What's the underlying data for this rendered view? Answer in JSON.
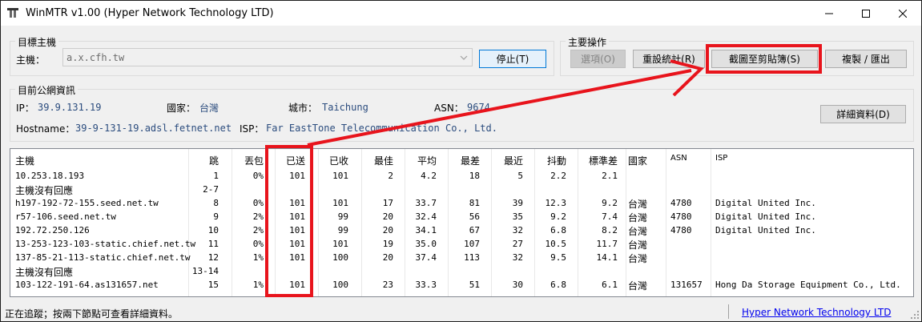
{
  "window": {
    "title": "WinMTR v1.00 (Hyper Network Technology LTD)",
    "minimize": "—",
    "maximize": "☐",
    "close": "✕"
  },
  "host_group": {
    "title": "目標主機",
    "host_label": "主機：",
    "host_value": "a.x.cfh.tw",
    "stop_button": "停止(T)"
  },
  "actions_group": {
    "title": "主要操作",
    "options_button": "選項(O)",
    "reset_button": "重設統計(R)",
    "screenshot_button": "截圖至剪貼簿(S)",
    "copy_export_button": "複製 / 匯出"
  },
  "ip_group": {
    "title": "目前公網資訊",
    "ip_label": "IP：",
    "ip_value": "39.9.131.19",
    "country_label": "國家：",
    "country_value": "台灣",
    "city_label": "城市：",
    "city_value": "Taichung",
    "asn_label": "ASN：",
    "asn_value": "9674",
    "hostname_label": "Hostname：",
    "hostname_value": "39-9-131-19.adsl.fetnet.net",
    "isp_label": "ISP：",
    "isp_value": "Far EastTone Telecommunication Co., Ltd.",
    "details_button": "詳細資料(D)"
  },
  "table": {
    "columns": [
      "主機",
      "跳",
      "丟包",
      "已送",
      "已收",
      "最佳",
      "平均",
      "最差",
      "最近",
      "抖動",
      "標準差",
      "國家",
      "ASN",
      "ISP"
    ],
    "rows": [
      [
        "10.253.18.193",
        "1",
        "0%",
        "101",
        "101",
        "2",
        "4.2",
        "18",
        "5",
        "2.2",
        "2.1",
        "",
        "",
        ""
      ],
      [
        "主機沒有回應",
        "2-7",
        "",
        "",
        "",
        "",
        "",
        "",
        "",
        "",
        "",
        "",
        "",
        ""
      ],
      [
        "h197-192-72-155.seed.net.tw",
        "8",
        "0%",
        "101",
        "101",
        "17",
        "33.7",
        "81",
        "39",
        "12.3",
        "9.2",
        "台灣",
        "4780",
        "Digital United Inc."
      ],
      [
        "r57-106.seed.net.tw",
        "9",
        "2%",
        "101",
        "99",
        "20",
        "32.4",
        "56",
        "35",
        "9.2",
        "7.4",
        "台灣",
        "4780",
        "Digital United Inc."
      ],
      [
        "192.72.250.126",
        "10",
        "2%",
        "101",
        "99",
        "20",
        "34.1",
        "67",
        "32",
        "6.8",
        "8.2",
        "台灣",
        "4780",
        "Digital United Inc."
      ],
      [
        "13-253-123-103-static.chief.net.tw",
        "11",
        "0%",
        "101",
        "101",
        "19",
        "35.0",
        "107",
        "27",
        "10.5",
        "11.7",
        "台灣",
        "",
        ""
      ],
      [
        "137-85-21-113-static.chief.net.tw",
        "12",
        "1%",
        "101",
        "100",
        "20",
        "37.4",
        "113",
        "32",
        "9.5",
        "14.1",
        "台灣",
        "",
        ""
      ],
      [
        "主機沒有回應",
        "13-14",
        "",
        "",
        "",
        "",
        "",
        "",
        "",
        "",
        "",
        "",
        "",
        ""
      ],
      [
        "103-122-191-64.as131657.net",
        "15",
        "1%",
        "101",
        "100",
        "23",
        "33.3",
        "51",
        "30",
        "6.8",
        "6.1",
        "台灣",
        "131657",
        "Hong Da Storage Equipment Co., Ltd."
      ]
    ]
  },
  "status": {
    "text": "正在追蹤；按兩下節點可查看詳細資料。",
    "link": "Hyper Network Technology LTD"
  },
  "colors": {
    "highlight": "#e8141c",
    "value_blue": "#2b4c7e",
    "link_blue": "#0000ee"
  }
}
